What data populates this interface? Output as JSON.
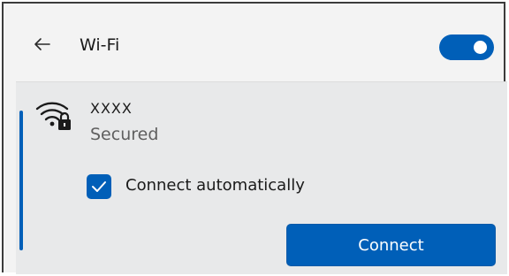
{
  "header": {
    "back_icon": "arrow-left-icon",
    "title": "Wi-Fi",
    "toggle_state": "on",
    "accent_color": "#005fb8"
  },
  "network": {
    "icon": "wifi-lock-icon",
    "name": "XXXX",
    "status": "Secured",
    "auto_connect": {
      "checked": true,
      "label": "Connect automatically"
    },
    "connect_label": "Connect"
  }
}
